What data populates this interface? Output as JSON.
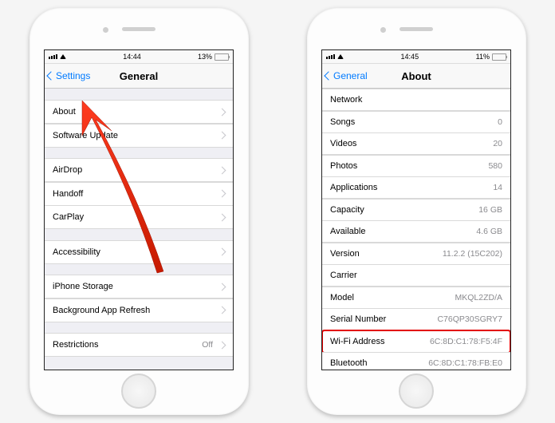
{
  "left": {
    "status": {
      "time": "14:44",
      "battery_pct": "13%",
      "battery_fill": 13
    },
    "nav": {
      "back": "Settings",
      "title": "General"
    },
    "groups": [
      [
        {
          "label": "About"
        },
        {
          "label": "Software Update"
        }
      ],
      [
        {
          "label": "AirDrop"
        },
        {
          "label": "Handoff"
        },
        {
          "label": "CarPlay"
        }
      ],
      [
        {
          "label": "Accessibility"
        }
      ],
      [
        {
          "label": "iPhone Storage"
        },
        {
          "label": "Background App Refresh"
        }
      ],
      [
        {
          "label": "Restrictions",
          "value": "Off"
        }
      ]
    ]
  },
  "right": {
    "status": {
      "time": "14:45",
      "battery_pct": "11%",
      "battery_fill": 11
    },
    "nav": {
      "back": "General",
      "title": "About"
    },
    "rows": [
      {
        "label": "Network",
        "value": ""
      },
      {
        "label": "Songs",
        "value": "0"
      },
      {
        "label": "Videos",
        "value": "20"
      },
      {
        "label": "Photos",
        "value": "580"
      },
      {
        "label": "Applications",
        "value": "14"
      },
      {
        "label": "Capacity",
        "value": "16 GB"
      },
      {
        "label": "Available",
        "value": "4.6 GB"
      },
      {
        "label": "Version",
        "value": "11.2.2 (15C202)"
      },
      {
        "label": "Carrier",
        "value": ""
      },
      {
        "label": "Model",
        "value": "MKQL2ZD/A"
      },
      {
        "label": "Serial Number",
        "value": "C76QP30SGRY7"
      },
      {
        "label": "Wi-Fi Address",
        "value": "6C:8D:C1:78:F5:4F",
        "highlight": true
      },
      {
        "label": "Bluetooth",
        "value": "6C:8D:C1:78:FB:E0"
      }
    ]
  }
}
